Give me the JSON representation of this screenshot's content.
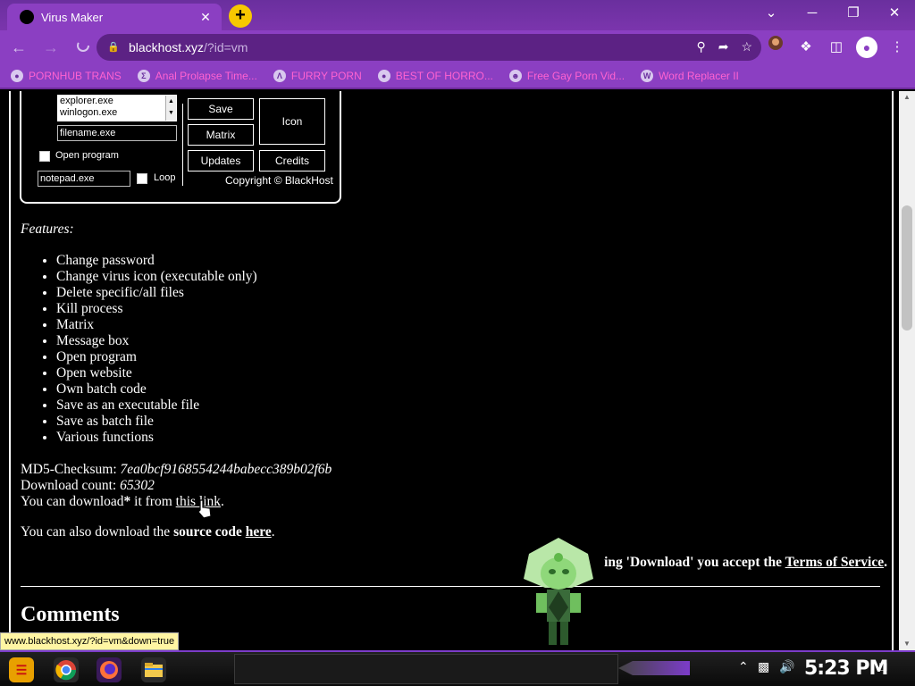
{
  "browser": {
    "tab_title": "Virus Maker",
    "tab_close": "✕",
    "new_tab": "+",
    "window_controls": [
      "⌄",
      "─",
      "❐",
      "✕"
    ],
    "url_host": "blackhost.xyz",
    "url_path": "/?id=vm"
  },
  "bookmarks": [
    {
      "label": "PORNHUB TRANS",
      "icon": "globe-icon"
    },
    {
      "label": "Anal Prolapse Time...",
      "icon": "sigma-icon"
    },
    {
      "label": "FURRY PORN",
      "icon": "lambda-icon"
    },
    {
      "label": "BEST OF HORRO...",
      "icon": "globe-icon"
    },
    {
      "label": "Free Gay Porn Vid...",
      "icon": "bot-icon"
    },
    {
      "label": "Word Replacer II",
      "icon": "wr-icon"
    }
  ],
  "vm": {
    "listbox_items": [
      "explorer.exe",
      "winlogon.exe"
    ],
    "filename_value": "filename.exe",
    "open_program_label": "Open program",
    "program_value": "notepad.exe",
    "loop_label": "Loop",
    "save_label": "Save",
    "icon_label": "Icon",
    "matrix_label": "Matrix",
    "updates_label": "Updates",
    "credits_label": "Credits",
    "copyright": "Copyright © BlackHost"
  },
  "content": {
    "features_heading": "Features:",
    "features": [
      "Change password",
      "Change virus icon (executable only)",
      "Delete specific/all files",
      "Kill process",
      "Matrix",
      "Message box",
      "Open program",
      "Open website",
      "Own batch code",
      "Save as an executable file",
      "Save as batch file",
      "Various functions"
    ],
    "md5_label": "MD5-Checksum: ",
    "md5_value": "7ea0bcf9168554244babecc389b02f6b",
    "download_count_label": "Download count: ",
    "download_count_value": "65302",
    "download_prefix": "You can download",
    "download_asterisk": "*",
    "download_middle": " it from ",
    "download_link": "this link",
    "download_suffix": ".",
    "source_prefix": "You can also download the ",
    "source_bold": "source code",
    "source_space": " ",
    "source_link": "here",
    "source_suffix": ".",
    "tos_prefix": "*",
    "tos_middle": "ing 'Download' you accept the ",
    "tos_link": "Terms of Service",
    "tos_suffix": ".",
    "comments_heading": "Comments"
  },
  "status_url": "www.blackhost.xyz/?id=vm&down=true",
  "taskbar": {
    "clock": "5:23 PM"
  },
  "colors": {
    "browser_purple": "#8b3fc2",
    "bookmark_text": "#ff62d1",
    "page_bg": "#000000",
    "newtab_yellow": "#f7c800"
  }
}
